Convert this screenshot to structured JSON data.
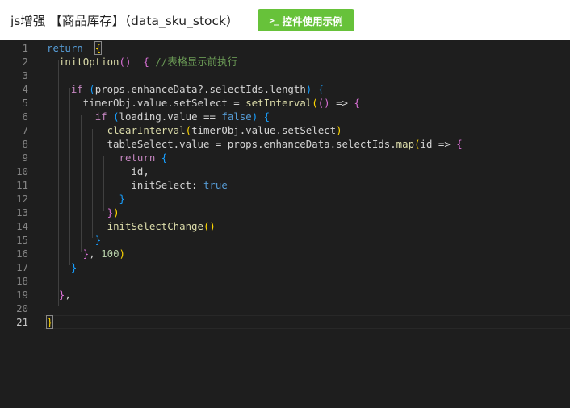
{
  "header": {
    "title": "js增强 【商品库存】（data_sku_stock）",
    "example_button": {
      "icon": ">_",
      "label": "控件使用示例"
    }
  },
  "editor": {
    "active_line": 21,
    "lines": [
      {
        "n": "1",
        "tokens": [
          [
            "kw",
            "return"
          ],
          [
            "",
            "  "
          ],
          [
            "b1 bm",
            "{"
          ]
        ]
      },
      {
        "n": "2",
        "tokens": [
          [
            "",
            "  "
          ],
          [
            "fn",
            "initOption"
          ],
          [
            "b2",
            "()"
          ],
          [
            "",
            "  "
          ],
          [
            "b2",
            "{"
          ],
          [
            "",
            ""
          ],
          [
            "cm",
            " //表格显示前执行"
          ]
        ]
      },
      {
        "n": "3",
        "tokens": []
      },
      {
        "n": "4",
        "tokens": [
          [
            "",
            "    "
          ],
          [
            "ctl",
            "if"
          ],
          [
            "",
            " "
          ],
          [
            "b3",
            "("
          ],
          [
            "",
            "props.enhanceData?.selectIds.length"
          ],
          [
            "b3",
            ")"
          ],
          [
            "",
            " "
          ],
          [
            "b3",
            "{"
          ]
        ]
      },
      {
        "n": "5",
        "tokens": [
          [
            "",
            "      timerObj.value.setSelect = "
          ],
          [
            "fn",
            "setInterval"
          ],
          [
            "b1",
            "("
          ],
          [
            "b2",
            "()"
          ],
          [
            "",
            " => "
          ],
          [
            "b2",
            "{"
          ]
        ]
      },
      {
        "n": "6",
        "tokens": [
          [
            "",
            "        "
          ],
          [
            "ctl",
            "if"
          ],
          [
            "",
            " "
          ],
          [
            "b3",
            "("
          ],
          [
            "",
            "loading.value == "
          ],
          [
            "kw",
            "false"
          ],
          [
            "b3",
            ")"
          ],
          [
            "",
            " "
          ],
          [
            "b3",
            "{"
          ]
        ]
      },
      {
        "n": "7",
        "tokens": [
          [
            "",
            "          "
          ],
          [
            "fn",
            "clearInterval"
          ],
          [
            "b1",
            "("
          ],
          [
            "",
            "timerObj.value.setSelect"
          ],
          [
            "b1",
            ")"
          ]
        ]
      },
      {
        "n": "8",
        "tokens": [
          [
            "",
            "          tableSelect.value = props.enhanceData.selectIds."
          ],
          [
            "fn",
            "map"
          ],
          [
            "b1",
            "("
          ],
          [
            "",
            "id => "
          ],
          [
            "b2",
            "{"
          ]
        ]
      },
      {
        "n": "9",
        "tokens": [
          [
            "",
            "            "
          ],
          [
            "ctl",
            "return"
          ],
          [
            "",
            " "
          ],
          [
            "b3",
            "{"
          ]
        ]
      },
      {
        "n": "10",
        "tokens": [
          [
            "",
            "              id,"
          ]
        ]
      },
      {
        "n": "11",
        "tokens": [
          [
            "",
            "              initSelect: "
          ],
          [
            "kw",
            "true"
          ]
        ]
      },
      {
        "n": "12",
        "tokens": [
          [
            "",
            "            "
          ],
          [
            "b3",
            "}"
          ]
        ]
      },
      {
        "n": "13",
        "tokens": [
          [
            "",
            "          "
          ],
          [
            "b2",
            "}"
          ],
          [
            "b1",
            ")"
          ]
        ]
      },
      {
        "n": "14",
        "tokens": [
          [
            "",
            "          "
          ],
          [
            "fn",
            "initSelectChange"
          ],
          [
            "b1",
            "()"
          ]
        ]
      },
      {
        "n": "15",
        "tokens": [
          [
            "",
            "        "
          ],
          [
            "b3",
            "}"
          ]
        ]
      },
      {
        "n": "16",
        "tokens": [
          [
            "",
            "      "
          ],
          [
            "b2",
            "}"
          ],
          [
            "",
            ", "
          ],
          [
            "num",
            "100"
          ],
          [
            "b1",
            ")"
          ]
        ]
      },
      {
        "n": "17",
        "tokens": [
          [
            "",
            "    "
          ],
          [
            "b3",
            "}"
          ]
        ]
      },
      {
        "n": "18",
        "tokens": []
      },
      {
        "n": "19",
        "tokens": [
          [
            "",
            "  "
          ],
          [
            "b2",
            "}"
          ],
          [
            "",
            ","
          ]
        ]
      },
      {
        "n": "20",
        "tokens": []
      },
      {
        "n": "21",
        "tokens": [
          [
            "b1 bm",
            "}"
          ]
        ]
      }
    ]
  }
}
